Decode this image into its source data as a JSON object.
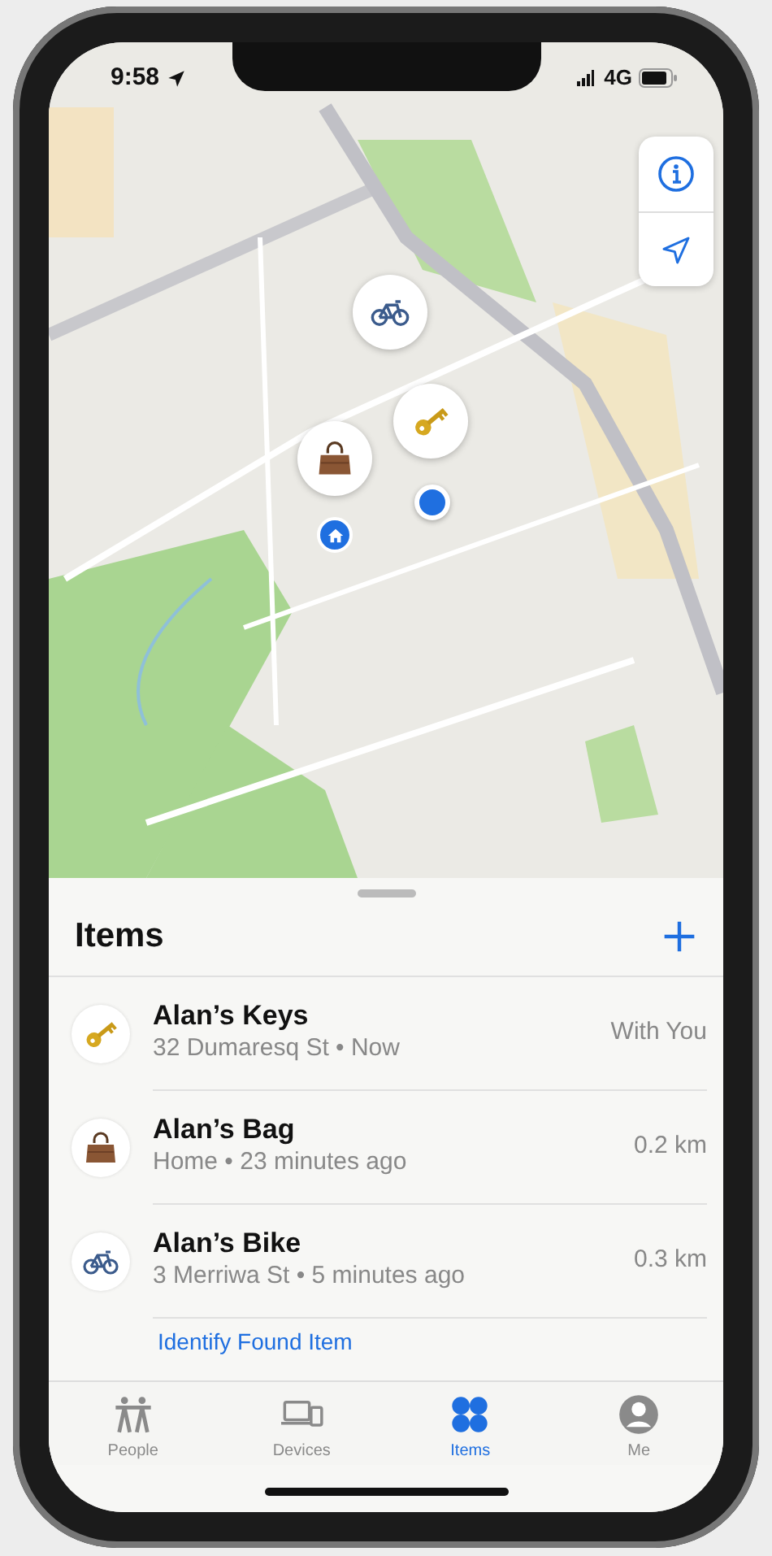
{
  "status_bar": {
    "time": "9:58",
    "network": "4G"
  },
  "sheet": {
    "title": "Items",
    "items": [
      {
        "kind": "key",
        "name": "Alan’s Keys",
        "detail": "32 Dumaresq St • Now",
        "distance": "With You"
      },
      {
        "kind": "bag",
        "name": "Alan’s Bag",
        "detail": "Home • 23 minutes ago",
        "distance": "0.2 km"
      },
      {
        "kind": "bike",
        "name": "Alan’s Bike",
        "detail": "3 Merriwa St • 5 minutes ago",
        "distance": "0.3 km"
      }
    ],
    "link": "Identify Found Item"
  },
  "tab_bar": [
    {
      "kind": "people",
      "label": "People",
      "selected": false
    },
    {
      "kind": "devices",
      "label": "Devices",
      "selected": false
    },
    {
      "kind": "items",
      "label": "Items",
      "selected": true
    },
    {
      "kind": "me",
      "label": "Me",
      "selected": false
    }
  ]
}
